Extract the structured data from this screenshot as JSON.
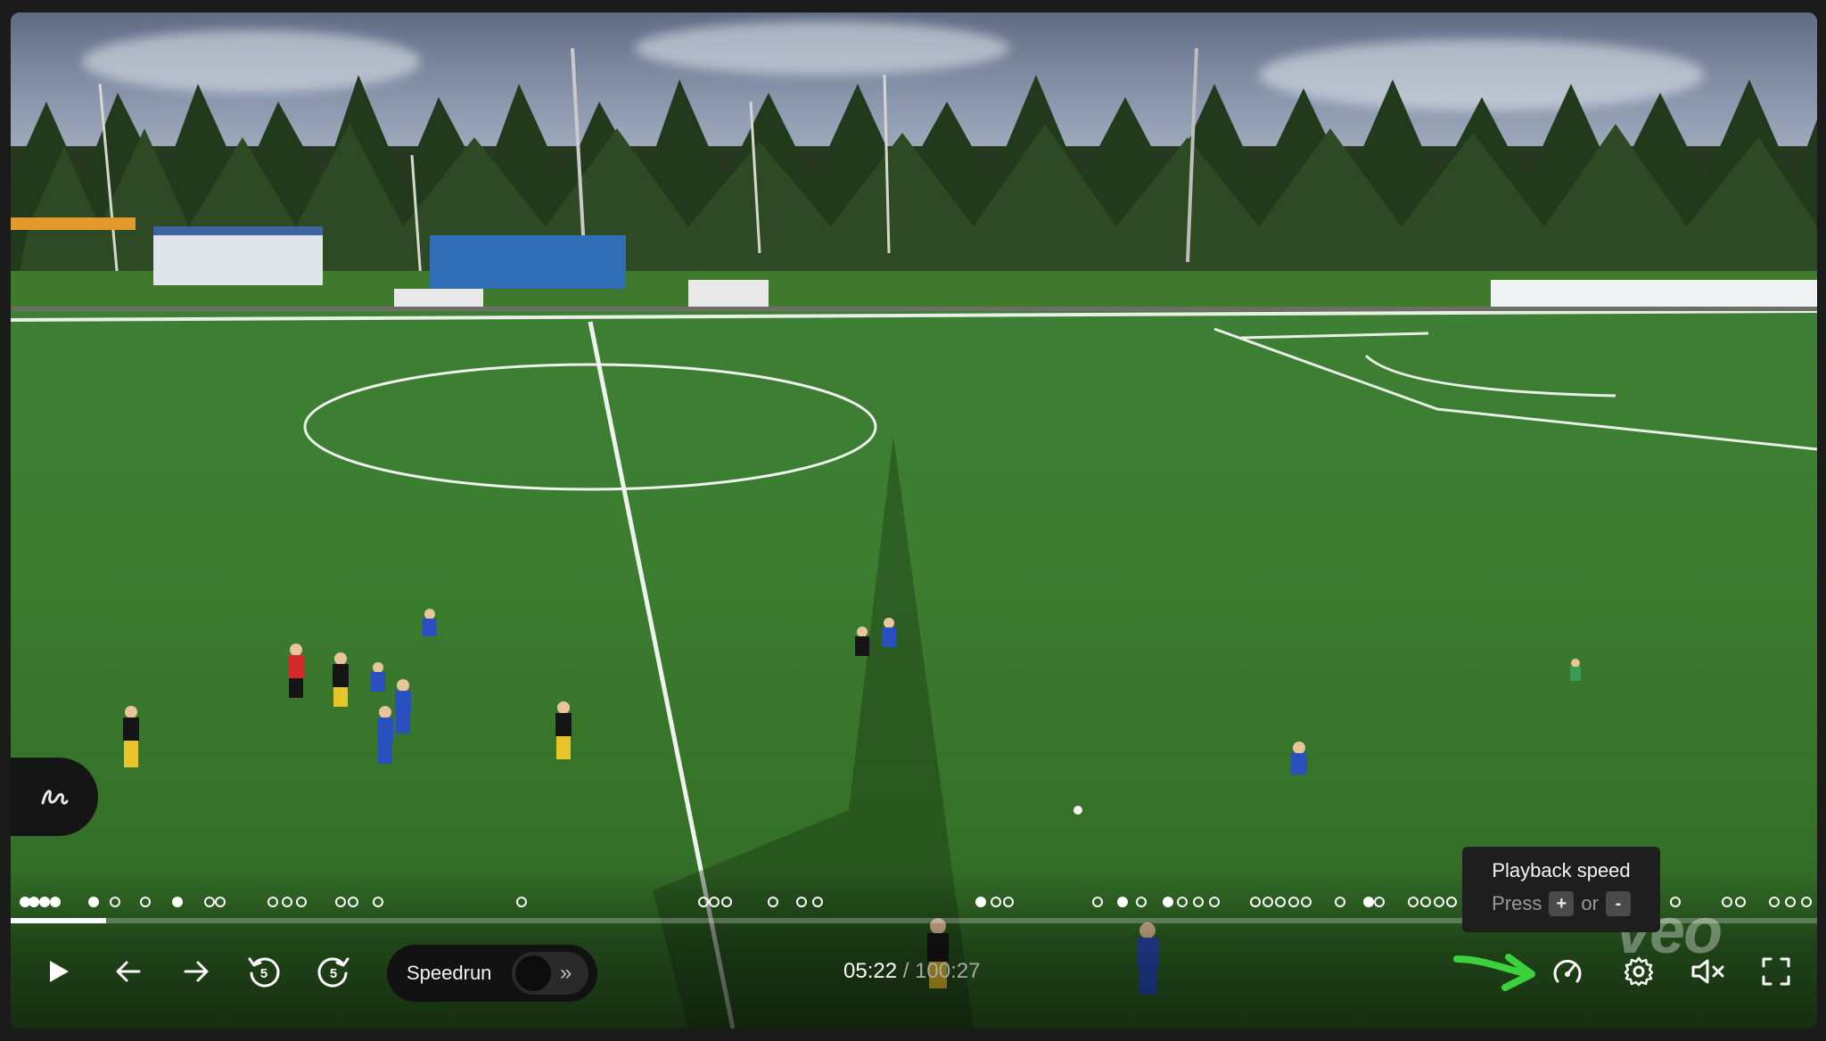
{
  "player": {
    "annotation_icon": "scribble-icon",
    "timeline": {
      "progress": 0.053,
      "events": [
        {
          "pos": 0.005,
          "filled": true
        },
        {
          "pos": 0.01,
          "filled": true
        },
        {
          "pos": 0.016,
          "filled": true
        },
        {
          "pos": 0.022,
          "filled": true
        },
        {
          "pos": 0.043,
          "filled": true
        },
        {
          "pos": 0.055,
          "filled": false
        },
        {
          "pos": 0.072,
          "filled": false
        },
        {
          "pos": 0.09,
          "filled": true
        },
        {
          "pos": 0.108,
          "filled": false
        },
        {
          "pos": 0.114,
          "filled": false
        },
        {
          "pos": 0.143,
          "filled": false
        },
        {
          "pos": 0.151,
          "filled": false
        },
        {
          "pos": 0.159,
          "filled": false
        },
        {
          "pos": 0.181,
          "filled": false
        },
        {
          "pos": 0.188,
          "filled": false
        },
        {
          "pos": 0.202,
          "filled": false
        },
        {
          "pos": 0.282,
          "filled": false
        },
        {
          "pos": 0.383,
          "filled": false
        },
        {
          "pos": 0.389,
          "filled": false
        },
        {
          "pos": 0.396,
          "filled": false
        },
        {
          "pos": 0.422,
          "filled": false
        },
        {
          "pos": 0.438,
          "filled": false
        },
        {
          "pos": 0.447,
          "filled": false
        },
        {
          "pos": 0.538,
          "filled": true
        },
        {
          "pos": 0.546,
          "filled": false
        },
        {
          "pos": 0.553,
          "filled": false
        },
        {
          "pos": 0.603,
          "filled": false
        },
        {
          "pos": 0.617,
          "filled": true
        },
        {
          "pos": 0.627,
          "filled": false
        },
        {
          "pos": 0.642,
          "filled": true
        },
        {
          "pos": 0.65,
          "filled": false
        },
        {
          "pos": 0.659,
          "filled": false
        },
        {
          "pos": 0.668,
          "filled": false
        },
        {
          "pos": 0.691,
          "filled": false
        },
        {
          "pos": 0.698,
          "filled": false
        },
        {
          "pos": 0.705,
          "filled": false
        },
        {
          "pos": 0.712,
          "filled": false
        },
        {
          "pos": 0.719,
          "filled": false
        },
        {
          "pos": 0.738,
          "filled": false
        },
        {
          "pos": 0.754,
          "filled": true
        },
        {
          "pos": 0.76,
          "filled": false
        },
        {
          "pos": 0.779,
          "filled": false
        },
        {
          "pos": 0.786,
          "filled": false
        },
        {
          "pos": 0.793,
          "filled": false
        },
        {
          "pos": 0.8,
          "filled": false
        },
        {
          "pos": 0.925,
          "filled": false
        },
        {
          "pos": 0.954,
          "filled": false
        },
        {
          "pos": 0.961,
          "filled": false
        },
        {
          "pos": 0.98,
          "filled": false
        },
        {
          "pos": 0.989,
          "filled": false
        },
        {
          "pos": 0.998,
          "filled": false
        }
      ]
    },
    "controls": {
      "play_icon": "play-icon",
      "back_icon": "arrow-left-icon",
      "forward_icon": "arrow-right-icon",
      "rewind5_icon": "rewind-5-icon",
      "forward5_icon": "forward-5-icon",
      "speedrun_label": "Speedrun",
      "speedrun_on": false,
      "current_time": "05:22",
      "separator": "/",
      "duration": "100:27",
      "speed_icon": "speedometer-icon",
      "settings_icon": "gear-icon",
      "mute_icon": "speaker-muted-icon",
      "fullscreen_icon": "fullscreen-icon"
    },
    "tooltip": {
      "title": "Playback speed",
      "press": "Press",
      "key_plus": "+",
      "or": "or",
      "key_minus": "-"
    },
    "watermark": "veo",
    "accent_arrow_color": "#3bd23d"
  }
}
